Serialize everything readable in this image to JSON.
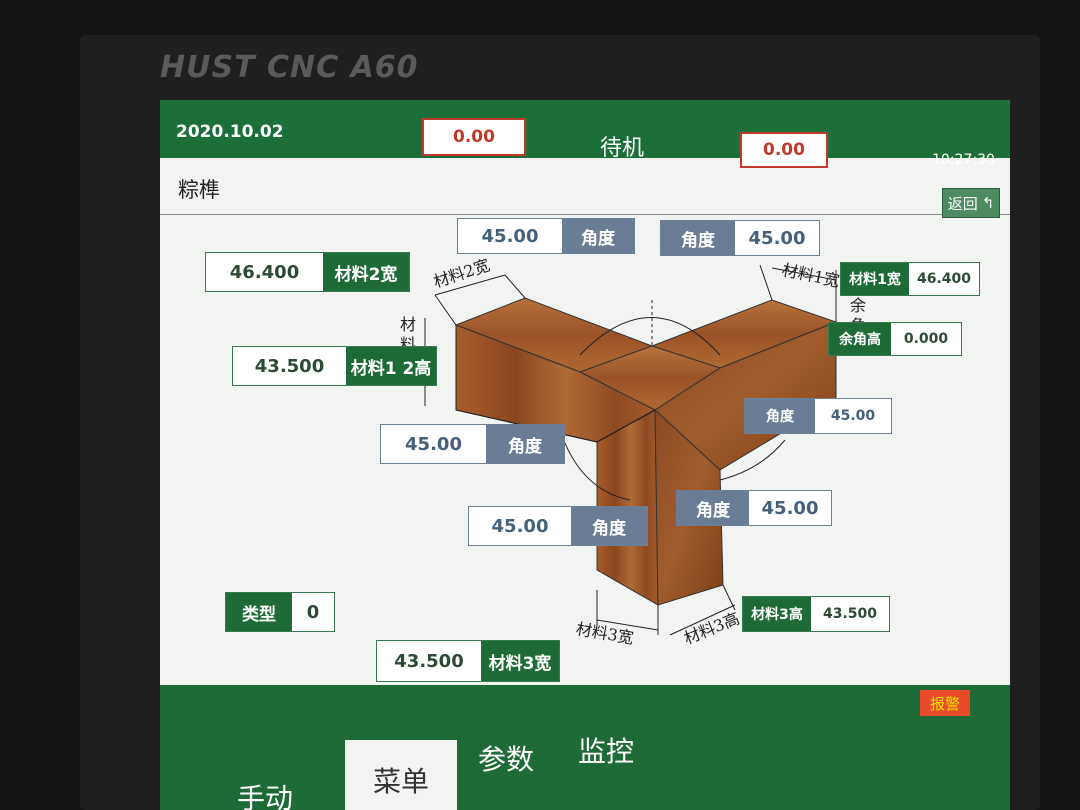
{
  "device": {
    "brand": "HUST CNC A60"
  },
  "header": {
    "date": "2020.10.02",
    "left_value": "0.00",
    "status": "待机",
    "right_value": "0.00",
    "time": "10:27:30"
  },
  "page": {
    "title": "粽榫",
    "back_label": "返回"
  },
  "fields": {
    "top_angle_left": {
      "value": "45.00",
      "label": "角度"
    },
    "top_angle_right": {
      "label": "角度",
      "value": "45.00"
    },
    "mat2_width": {
      "value": "46.400",
      "label": "材料2宽"
    },
    "mat1_width": {
      "label": "材料1宽",
      "value": "46.400"
    },
    "mat12_height": {
      "value": "43.500",
      "label": "材料1 2高"
    },
    "corner_height": {
      "label": "余角高",
      "value": "0.000"
    },
    "right_angle_upper": {
      "label": "角度",
      "value": "45.00"
    },
    "left_angle_mid": {
      "value": "45.00",
      "label": "角度"
    },
    "left_angle_low": {
      "value": "45.00",
      "label": "角度"
    },
    "right_angle_low": {
      "label": "角度",
      "value": "45.00"
    },
    "type": {
      "label": "类型",
      "value": "0"
    },
    "mat3_height": {
      "label": "材料3高",
      "value": "43.500"
    },
    "mat3_width": {
      "value": "43.500",
      "label": "材料3宽"
    }
  },
  "diagram_labels": {
    "mat2_width": "材料2宽",
    "mat1_width": "材料1宽",
    "mat_height_vertical": "材料高",
    "corner_vertical": "余角",
    "mat3_width": "材料3宽",
    "mat3_height": "材料3高"
  },
  "tabs": [
    "手动",
    "菜单",
    "参数",
    "监控"
  ],
  "alarm": "报警",
  "colors": {
    "header_green": "#1d6f3a",
    "label_green": "#1f6b38",
    "label_blue": "#6b7d94",
    "wood": "#a0592a",
    "alert_red": "#c0392b"
  }
}
